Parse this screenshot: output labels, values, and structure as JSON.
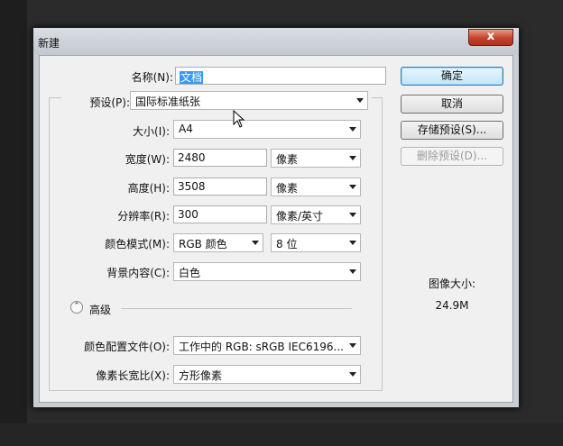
{
  "window": {
    "title": "新建",
    "close_label": "x"
  },
  "form": {
    "name_label": "名称(N):",
    "name_value": "文档",
    "preset_label": "预设(P):",
    "preset_value": "国际标准纸张",
    "size_label": "大小(I):",
    "size_value": "A4",
    "width_label": "宽度(W):",
    "width_value": "2480",
    "width_unit": "像素",
    "height_label": "高度(H):",
    "height_value": "3508",
    "height_unit": "像素",
    "resolution_label": "分辨率(R):",
    "resolution_value": "300",
    "resolution_unit": "像素/英寸",
    "color_mode_label": "颜色模式(M):",
    "color_mode_value": "RGB 颜色",
    "bit_depth": "8 位",
    "background_label": "背景内容(C):",
    "background_value": "白色",
    "advanced_label": "高级",
    "profile_label": "颜色配置文件(O):",
    "profile_value": "工作中的 RGB: sRGB IEC6196...",
    "pixel_aspect_label": "像素长宽比(X):",
    "pixel_aspect_value": "方形像素"
  },
  "buttons": {
    "ok": "确定",
    "cancel": "取消",
    "save_preset": "存储预设(S)...",
    "delete_preset": "删除预设(D)..."
  },
  "image_size": {
    "label": "图像大小:",
    "value": "24.9M"
  }
}
